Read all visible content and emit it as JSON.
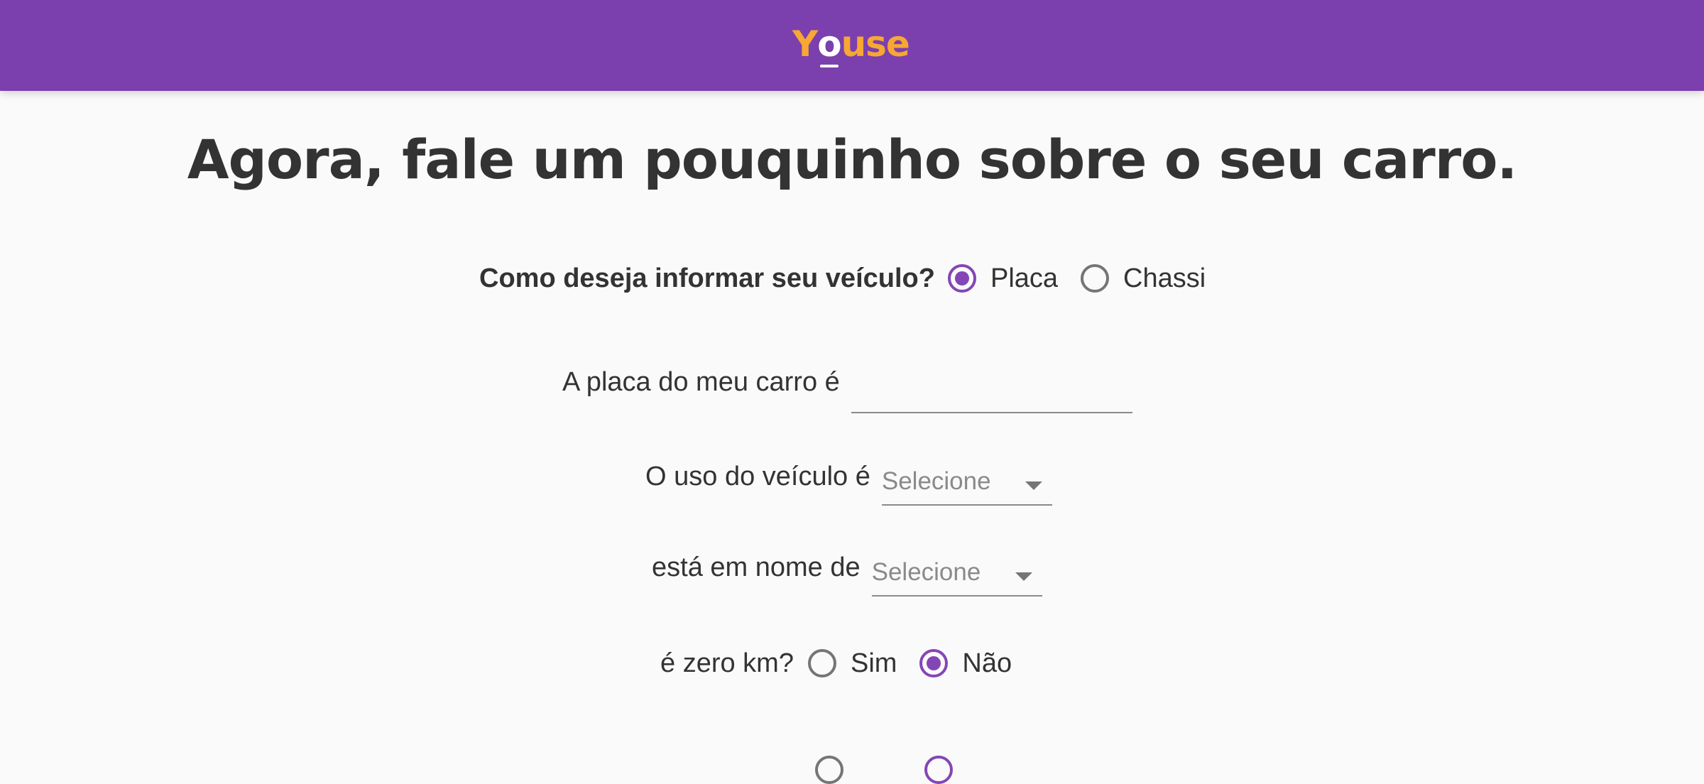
{
  "header": {
    "logo_text_1": "Y",
    "logo_text_o": "o",
    "logo_text_2": "use"
  },
  "page_title": "Agora, fale um pouquinho sobre o seu carro.",
  "vehicle_id": {
    "question": "Como deseja informar seu veículo?",
    "options": [
      "Placa",
      "Chassi"
    ],
    "selected": "Placa"
  },
  "plate": {
    "label": "A placa do meu carro é",
    "value": "",
    "placeholder": ""
  },
  "usage": {
    "label": "O uso do veículo é",
    "selected": "Selecione"
  },
  "owner": {
    "label": "está em nome de",
    "selected": "Selecione"
  },
  "zero_km": {
    "question": "é zero km?",
    "options": [
      "Sim",
      "Não"
    ],
    "selected": "Não"
  },
  "colors": {
    "header_bg": "#7b40ad",
    "logo": "#f7a734",
    "accent": "#8446b6",
    "text": "#333333"
  }
}
